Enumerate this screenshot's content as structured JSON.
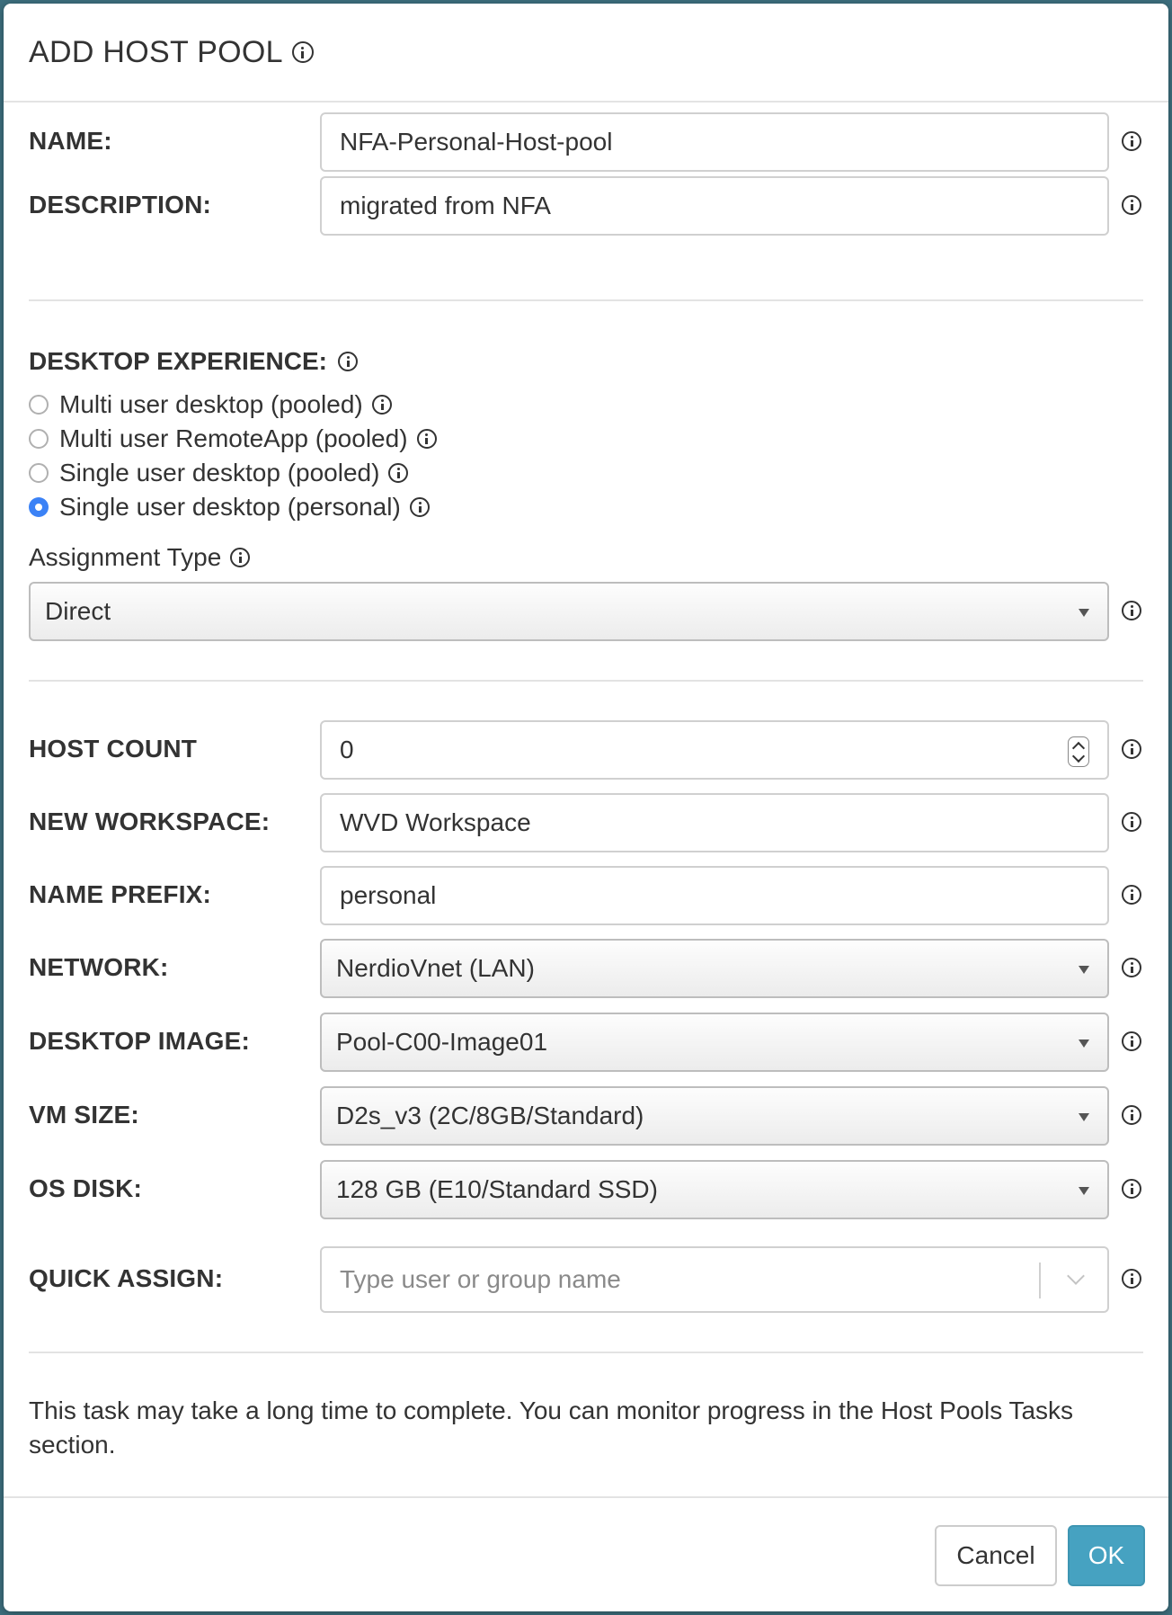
{
  "dialog": {
    "title": "ADD HOST POOL"
  },
  "fields": {
    "name": {
      "label": "NAME:",
      "value": "NFA-Personal-Host-pool"
    },
    "description": {
      "label": "DESCRIPTION:",
      "value": "migrated from NFA"
    }
  },
  "desktop_experience": {
    "label": "DESKTOP EXPERIENCE:",
    "options": [
      {
        "label": "Multi user desktop (pooled)",
        "selected": false
      },
      {
        "label": "Multi user RemoteApp (pooled)",
        "selected": false
      },
      {
        "label": "Single user desktop (pooled)",
        "selected": false
      },
      {
        "label": "Single user desktop (personal)",
        "selected": true
      }
    ],
    "assignment_type_label": "Assignment Type",
    "assignment_type_value": "Direct"
  },
  "config": {
    "host_count": {
      "label": "HOST COUNT",
      "value": "0"
    },
    "new_workspace": {
      "label": "NEW WORKSPACE:",
      "value": "WVD Workspace"
    },
    "name_prefix": {
      "label": "NAME PREFIX:",
      "value": "personal"
    },
    "network": {
      "label": "NETWORK:",
      "value": "NerdioVnet (LAN)"
    },
    "desktop_image": {
      "label": "DESKTOP IMAGE:",
      "value": "Pool-C00-Image01"
    },
    "vm_size": {
      "label": "VM SIZE:",
      "value": "D2s_v3 (2C/8GB/Standard)"
    },
    "os_disk": {
      "label": "OS DISK:",
      "value": "128 GB (E10/Standard SSD)"
    },
    "quick_assign": {
      "label": "QUICK ASSIGN:",
      "placeholder": "Type user or group name"
    }
  },
  "note": "This task may take a long time to complete. You can monitor progress in the Host Pools Tasks section.",
  "buttons": {
    "cancel": "Cancel",
    "ok": "OK"
  },
  "colors": {
    "primary_button": "#46a2c1",
    "radio_selected": "#3b82f6"
  }
}
